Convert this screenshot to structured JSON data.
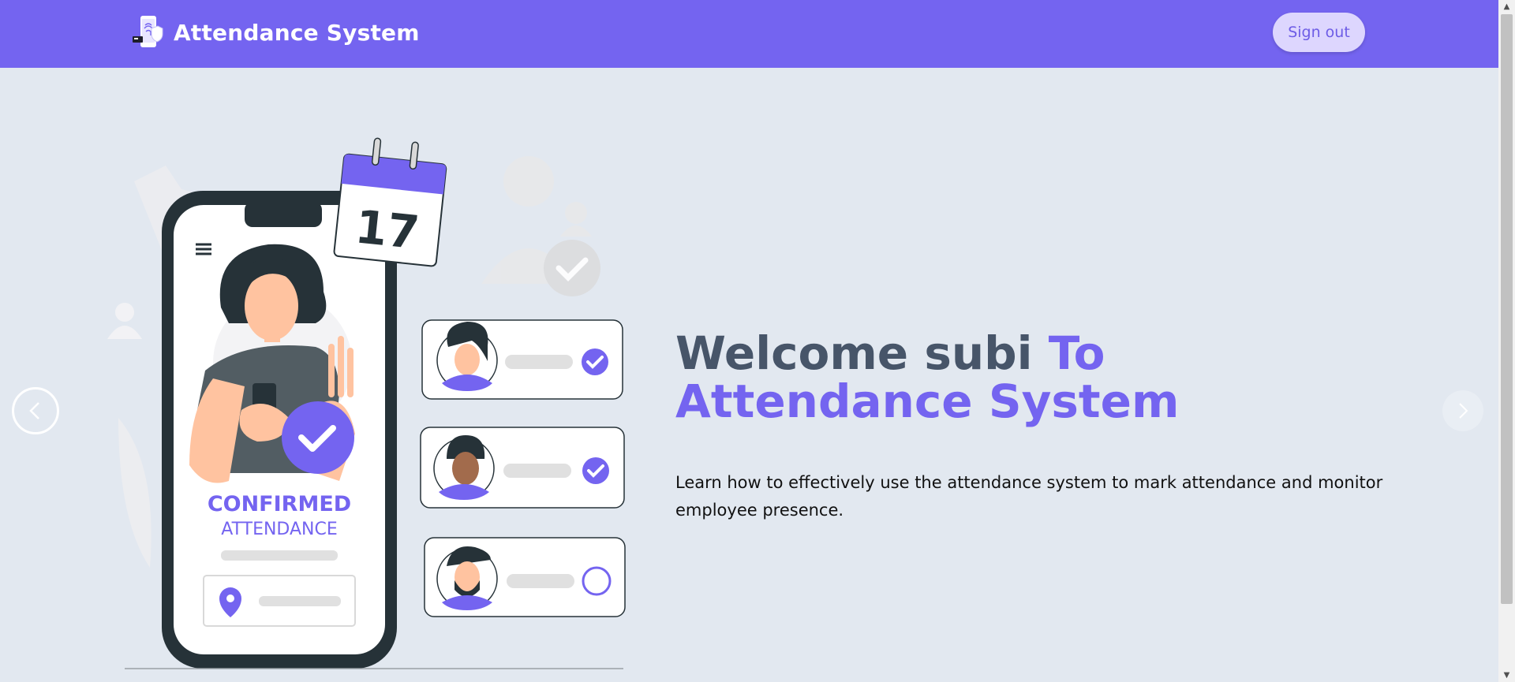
{
  "header": {
    "title": "Attendance System",
    "signout_label": "Sign out",
    "logo_icon": "fingerprint-phone-icon"
  },
  "hero": {
    "greeting": "Welcome subi",
    "title_accent_1": "To",
    "title_accent_2": "Attendance System",
    "description": "Learn how to effectively use the attendance system to mark attendance and monitor employee presence."
  },
  "illustration": {
    "calendar_day": "17",
    "confirmed_label": "CONFIRMED",
    "attendance_label": "ATTENDANCE"
  },
  "carousel": {
    "prev_icon": "chevron-left-icon",
    "next_icon": "chevron-right-icon"
  },
  "colors": {
    "accent": "#7464f0",
    "background": "#e2e8f0",
    "signout_bg": "#ddd6fe"
  }
}
